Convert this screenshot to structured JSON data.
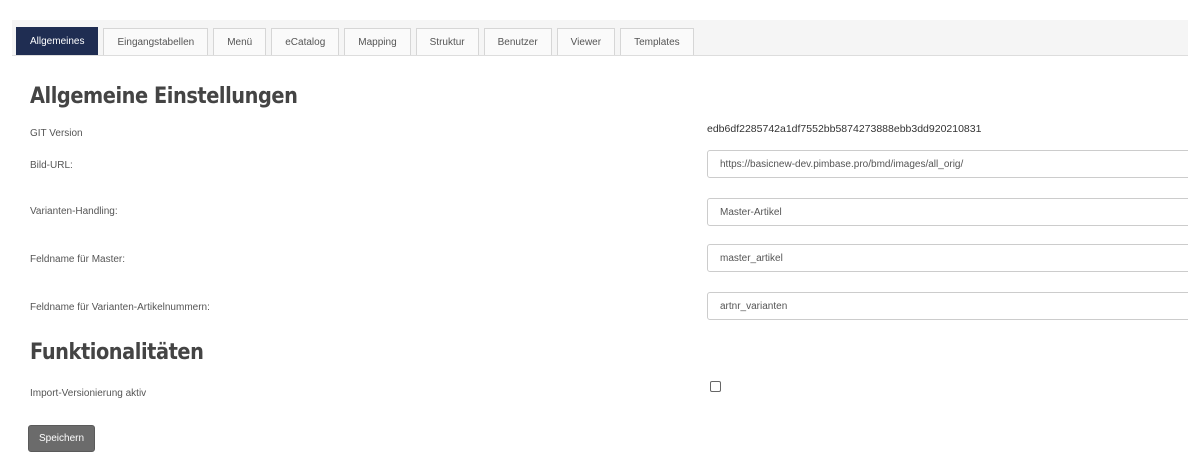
{
  "tabs": [
    {
      "label": "Allgemeines",
      "active": true
    },
    {
      "label": "Eingangstabellen",
      "active": false
    },
    {
      "label": "Menü",
      "active": false
    },
    {
      "label": "eCatalog",
      "active": false
    },
    {
      "label": "Mapping",
      "active": false
    },
    {
      "label": "Struktur",
      "active": false
    },
    {
      "label": "Benutzer",
      "active": false
    },
    {
      "label": "Viewer",
      "active": false
    },
    {
      "label": "Templates",
      "active": false
    }
  ],
  "general": {
    "title": "Allgemeine Einstellungen",
    "git_version_label": "GIT Version",
    "git_version_value": "edb6df2285742a1df7552bb5874273888ebb3dd920210831",
    "image_url_label": "Bild-URL:",
    "image_url_value": "https://basicnew-dev.pimbase.pro/bmd/images/all_orig/",
    "variant_handling_label": "Varianten-Handling:",
    "variant_handling_value": "Master-Artikel",
    "master_field_label": "Feldname für Master:",
    "master_field_value": "master_artikel",
    "variant_numbers_label": "Feldname für Varianten-Artikelnummern:",
    "variant_numbers_value": "artnr_varianten"
  },
  "features": {
    "title": "Funktionalitäten",
    "import_versioning_label": "Import-Versionierung aktiv",
    "import_versioning_checked": false
  },
  "actions": {
    "save_label": "Speichern"
  },
  "colors": {
    "active_tab": "#1f2d52",
    "save_button": "#6b6b6b"
  }
}
